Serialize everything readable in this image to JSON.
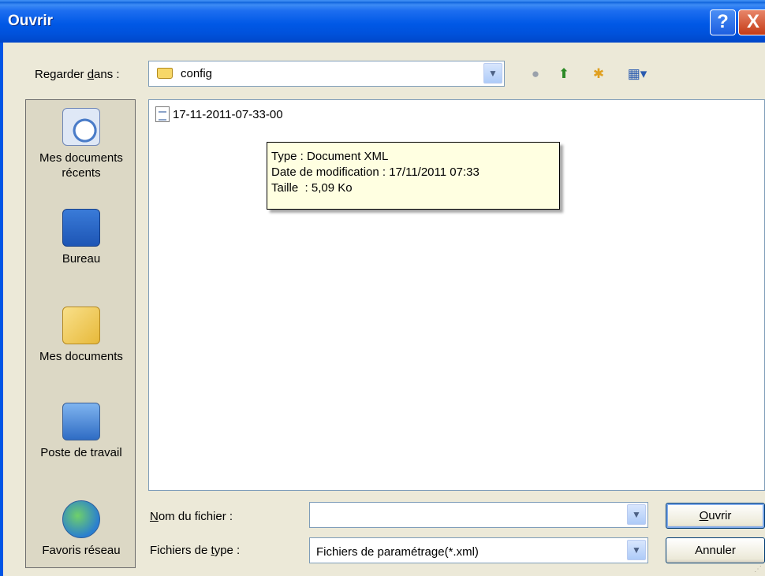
{
  "window": {
    "title": "Ouvrir",
    "help_glyph": "?",
    "close_glyph": "X"
  },
  "look_in": {
    "label": "Regarder dans :",
    "label_pre": "Regarder ",
    "label_mnemonic": "d",
    "label_post": "ans :",
    "value": "config"
  },
  "toolbar": {
    "back": "back-icon",
    "up": "up-folder-icon",
    "new_folder": "new-folder-icon",
    "view_menu": "view-menu-icon"
  },
  "places": [
    {
      "label": "Mes documents récents",
      "line1": "Mes documents",
      "line2": "récents",
      "icon": "recent-documents-icon"
    },
    {
      "label": "Bureau",
      "icon": "desktop-icon"
    },
    {
      "label": "Mes documents",
      "icon": "my-documents-icon"
    },
    {
      "label": "Poste de travail",
      "icon": "my-computer-icon"
    },
    {
      "label": "Favoris réseau",
      "icon": "network-places-icon"
    }
  ],
  "files": [
    {
      "name": "17-11-2011-07-33-00",
      "icon": "xml-file-icon"
    }
  ],
  "tooltip": {
    "type_line": "Type : Document XML",
    "date_line": "Date de modification : 17/11/2011 07:33",
    "size_line": "Taille  : 5,09 Ko"
  },
  "filename": {
    "label_mnemonic": "N",
    "label_rest": "om du fichier :",
    "value": ""
  },
  "filetype": {
    "label_pre": "Fichiers de ",
    "label_mnemonic": "t",
    "label_post": "ype :",
    "value": "Fichiers de paramétrage(*.xml)"
  },
  "buttons": {
    "open_mnemonic": "O",
    "open_rest": "uvrir",
    "cancel": "Annuler"
  },
  "colors": {
    "titlebar": "#0058e6",
    "dialog_bg": "#ece9d8",
    "tooltip_bg": "#ffffe1"
  }
}
